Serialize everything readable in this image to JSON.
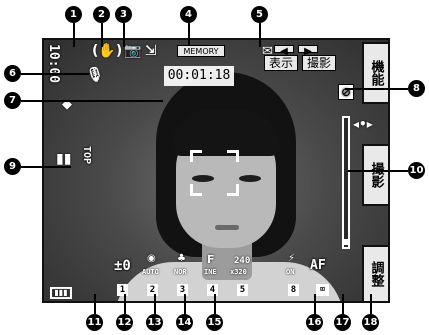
{
  "screen": {
    "memory_label": "MEMORY",
    "timecode": "00:01:18",
    "time_vertical": "10:00",
    "brightness": "±0",
    "buttons": {
      "display": "表示",
      "shoot": "撮影",
      "function": "機能",
      "capture": "撮影",
      "adjust": "調整"
    },
    "top_badge": "TOP",
    "settings_row": {
      "exposure_chip": "1",
      "white_balance_label": "AUTO",
      "white_balance_chip": "2",
      "quality_label": "NOR",
      "quality_chip": "3",
      "file_label": "INE",
      "file_chip": "4",
      "size_top": "240",
      "size_bottom": "x320",
      "size_chip": "5",
      "flash_label": "ON",
      "flash_chip": "8",
      "af_label": "AF"
    }
  },
  "callouts": [
    "1",
    "2",
    "3",
    "4",
    "5",
    "6",
    "7",
    "8",
    "9",
    "10",
    "11",
    "12",
    "13",
    "14",
    "15",
    "16",
    "17",
    "18"
  ],
  "colors": {
    "callout": "#000000",
    "overlay_text": "#ffffff",
    "button_bg": "#e9e9e9"
  }
}
